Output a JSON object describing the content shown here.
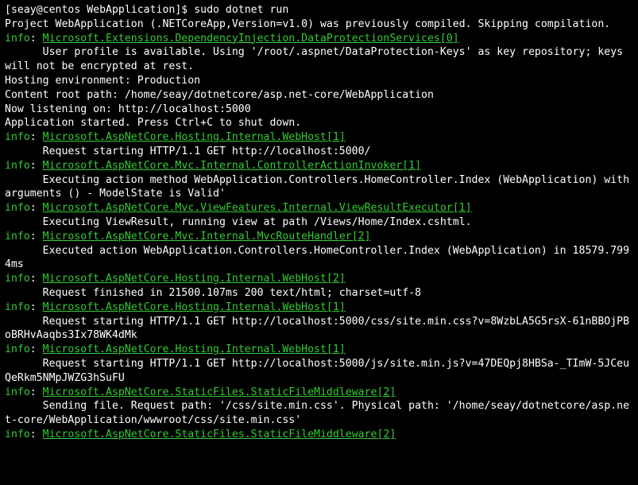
{
  "prompt": "[seay@centos WebApplication]$ ",
  "command": "sudo dotnet run",
  "startup": [
    "Project WebApplication (.NETCoreApp,Version=v1.0) was previously compiled. Skipping compilation."
  ],
  "lines": [
    {
      "type": "info",
      "logger": "Microsoft.Extensions.DependencyInjection.DataProtectionServices[0]"
    },
    {
      "type": "msg",
      "text": "      User profile is available. Using '/root/.aspnet/DataProtection-Keys' as key repository; keys will not be encrypted at rest."
    },
    {
      "type": "plain",
      "text": "Hosting environment: Production"
    },
    {
      "type": "plain",
      "text": "Content root path: /home/seay/dotnetcore/asp.net-core/WebApplication"
    },
    {
      "type": "plain",
      "text": "Now listening on: http://localhost:5000"
    },
    {
      "type": "plain",
      "text": "Application started. Press Ctrl+C to shut down."
    },
    {
      "type": "info",
      "logger": "Microsoft.AspNetCore.Hosting.Internal.WebHost[1]"
    },
    {
      "type": "msg",
      "text": "      Request starting HTTP/1.1 GET http://localhost:5000/"
    },
    {
      "type": "info",
      "logger": "Microsoft.AspNetCore.Mvc.Internal.ControllerActionInvoker[1]"
    },
    {
      "type": "msg",
      "text": "      Executing action method WebApplication.Controllers.HomeController.Index (WebApplication) with arguments () - ModelState is Valid'"
    },
    {
      "type": "info",
      "logger": "Microsoft.AspNetCore.Mvc.ViewFeatures.Internal.ViewResultExecutor[1]"
    },
    {
      "type": "msg",
      "text": "      Executing ViewResult, running view at path /Views/Home/Index.cshtml."
    },
    {
      "type": "info",
      "logger": "Microsoft.AspNetCore.Mvc.Internal.MvcRouteHandler[2]"
    },
    {
      "type": "msg",
      "text": "      Executed action WebApplication.Controllers.HomeController.Index (WebApplication) in 18579.7994ms"
    },
    {
      "type": "info",
      "logger": "Microsoft.AspNetCore.Hosting.Internal.WebHost[2]"
    },
    {
      "type": "msg",
      "text": "      Request finished in 21500.107ms 200 text/html; charset=utf-8"
    },
    {
      "type": "info",
      "logger": "Microsoft.AspNetCore.Hosting.Internal.WebHost[1]"
    },
    {
      "type": "msg",
      "text": "      Request starting HTTP/1.1 GET http://localhost:5000/css/site.min.css?v=8WzbLA5G5rsX-61nBBOjPBoBRHvAaqbs3Ix78WK4dMk"
    },
    {
      "type": "info",
      "logger": "Microsoft.AspNetCore.Hosting.Internal.WebHost[1]"
    },
    {
      "type": "msg",
      "text": "      Request starting HTTP/1.1 GET http://localhost:5000/js/site.min.js?v=47DEQpj8HBSa-_TImW-5JCeuQeRkm5NMpJWZG3hSuFU"
    },
    {
      "type": "info",
      "logger": "Microsoft.AspNetCore.StaticFiles.StaticFileMiddleware[2]"
    },
    {
      "type": "msg",
      "text": "      Sending file. Request path: '/css/site.min.css'. Physical path: '/home/seay/dotnetcore/asp.net-core/WebApplication/wwwroot/css/site.min.css'"
    },
    {
      "type": "info",
      "logger": "Microsoft.AspNetCore.StaticFiles.StaticFileMiddleware[2]"
    }
  ],
  "info_prefix": "info",
  "colon": ": "
}
